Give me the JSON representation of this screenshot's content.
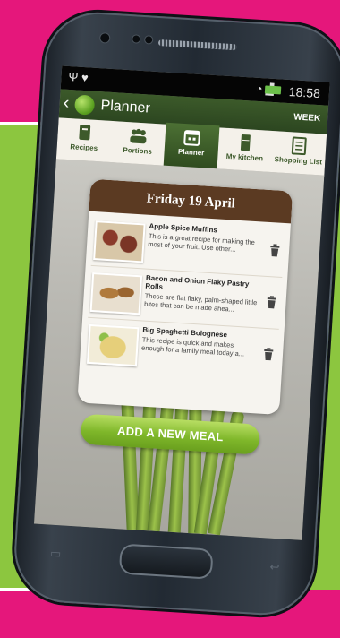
{
  "statusbar": {
    "left_icons": "Ψ ♥",
    "signal": "WiFi",
    "time": "18:58"
  },
  "appbar": {
    "back": "‹",
    "title": "Planner",
    "week_button": "WEEK"
  },
  "tabs": [
    {
      "label": "Recipes",
      "icon": "recipe-book-icon"
    },
    {
      "label": "Portions",
      "icon": "people-icon"
    },
    {
      "label": "Planner",
      "icon": "calendar-icon",
      "active": true
    },
    {
      "label": "My kitchen",
      "icon": "fridge-icon"
    },
    {
      "label": "Shopping List",
      "icon": "checklist-icon"
    }
  ],
  "day": {
    "title": "Friday 19 April"
  },
  "meals": [
    {
      "title": "Apple Spice Muffins",
      "description": "This is a great recipe for making the most of your fruit. Use other..."
    },
    {
      "title": "Bacon and Onion Flaky Pastry Rolls",
      "description": "These are flat flaky, palm-shaped little bites that can be made ahea..."
    },
    {
      "title": "Big Spaghetti Bolognese",
      "description": "This recipe is quick and makes enough for a family meal today a..."
    }
  ],
  "add_button": "ADD A NEW MEAL",
  "colors": {
    "background_pink": "#e5177b",
    "panel_green": "#8cc63f",
    "header_brown": "#5b3a22",
    "accent_green": "#7fb72a"
  }
}
